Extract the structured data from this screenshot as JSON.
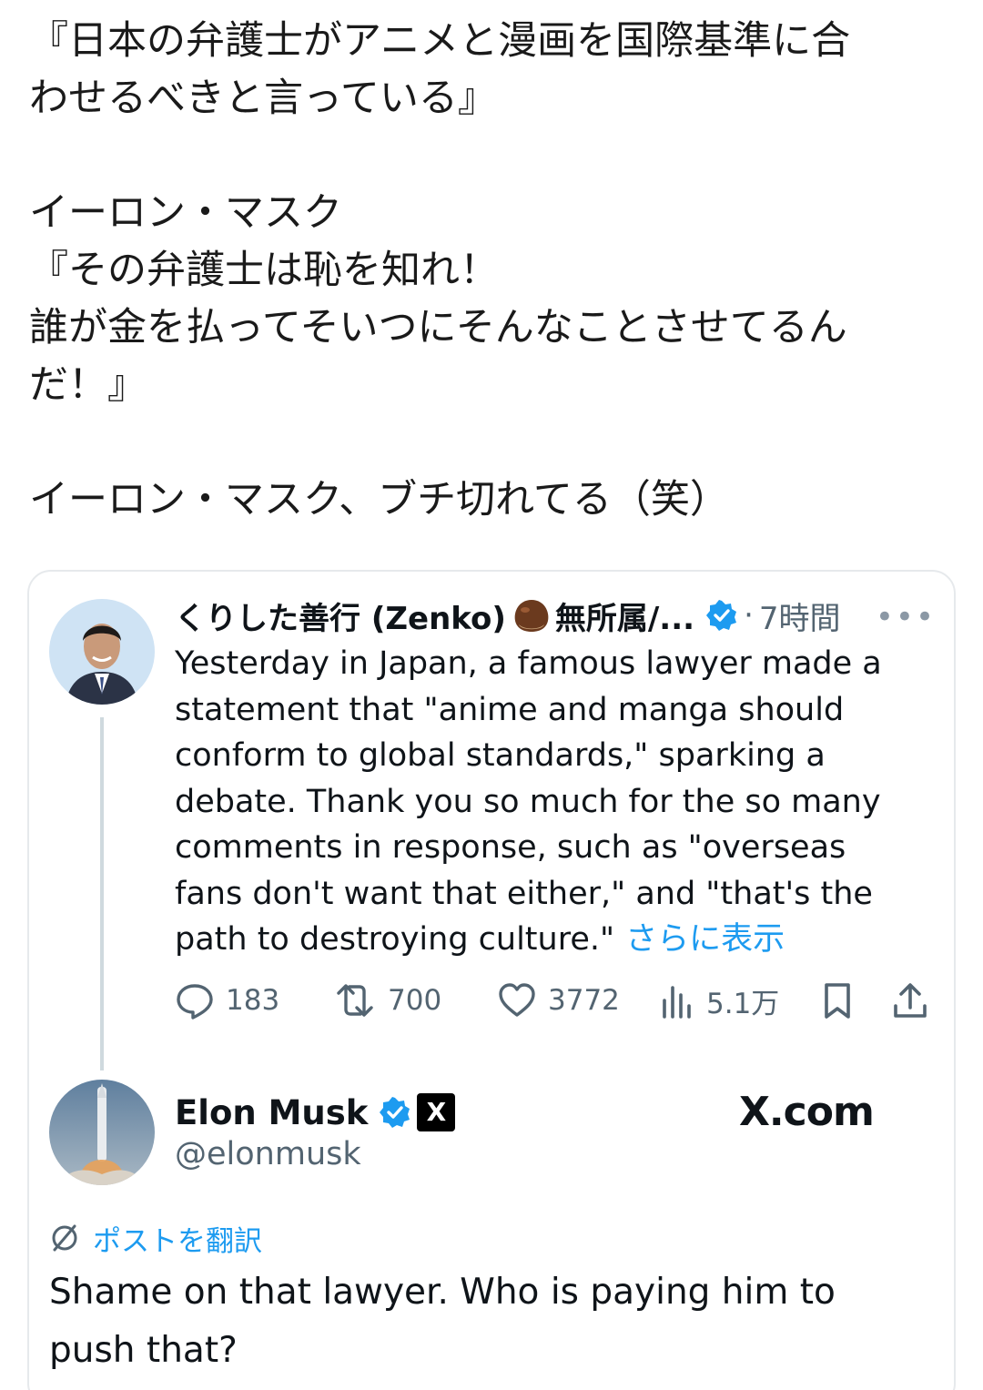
{
  "intro": {
    "lines": [
      "『日本の弁護士がアニメと漫画を国際基準に合",
      "わせるべきと言っている』",
      "",
      "イーロン・マスク",
      "『その弁護士は恥を知れ！",
      "誰が金を払ってそいつにそんなことさせてるん",
      "だ！』",
      "",
      "イーロン・マスク、ブチ切れてる（笑）"
    ]
  },
  "quoted_post": {
    "display_name": "くりした善行 (Zenko)",
    "name_suffix": "無所属/...",
    "separator": "·",
    "time": "7時間",
    "more": "•••",
    "text": "Yesterday in Japan, a famous lawyer made a statement that \"anime and manga should conform to global standards,\" sparking a debate. Thank you so much for the so many comments in response, such as \"overseas fans don't want that either,\" and \"that's the path to destroying culture.\"",
    "show_more": "さらに表示",
    "stats": {
      "replies": "183",
      "reposts": "700",
      "likes": "3772",
      "views": "5.1万"
    }
  },
  "reply": {
    "display_name": "Elon Musk",
    "handle": "@elonmusk",
    "badge": "X",
    "brand": "X.com",
    "translate_label": "ポストを翻訳",
    "text": "Shame on that lawyer. Who is paying him to push that?"
  },
  "colors": {
    "accent": "#1d9bf0",
    "muted": "#536471",
    "text": "#0f1419",
    "border": "#e6e9ec"
  },
  "icons": [
    "chestnut-icon",
    "verified-badge-icon",
    "more-icon",
    "reply-icon",
    "repost-icon",
    "like-icon",
    "views-icon",
    "bookmark-icon",
    "share-icon",
    "x-logo-icon",
    "translate-icon"
  ]
}
